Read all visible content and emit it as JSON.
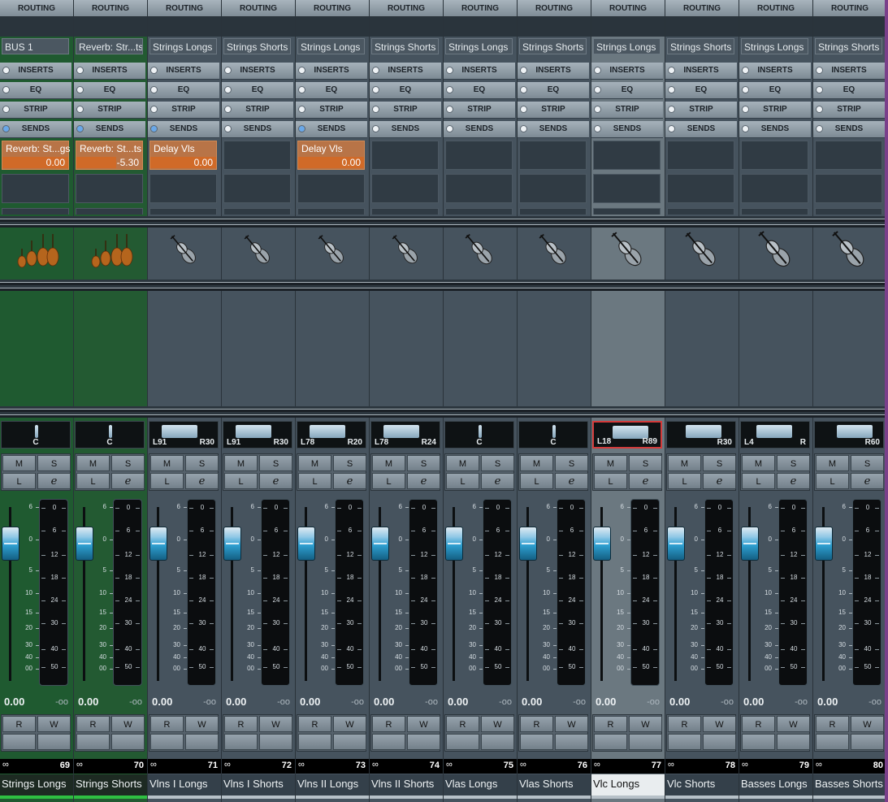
{
  "section_labels": {
    "routing": "ROUTING",
    "inserts": "INSERTS",
    "eq": "EQ",
    "strip": "STRIP",
    "sends": "SENDS"
  },
  "buttons": {
    "mute": "M",
    "solo": "S",
    "listen": "L",
    "edit": "e",
    "read": "R",
    "write": "W"
  },
  "colors": {
    "green_channel": "#1f5a30",
    "green_channel_alt": "#235a32",
    "gray_channel": "#46535e",
    "selected_channel": "#6b7880",
    "green_colorbar": "#2fbf42",
    "gray_colorbar": "#b7c1c8",
    "selected_name_bg": "#e9edef",
    "send_active": "#b87447",
    "selected_pan_border": "#d33b3b",
    "fader_blue": "#2e9fd0"
  },
  "fader_scale": [
    "6",
    "0",
    "5",
    "10",
    "15",
    "20",
    "30",
    "40",
    "00"
  ],
  "meter_scale": [
    "0",
    "6",
    "12",
    "18",
    "24",
    "30",
    "40",
    "50"
  ],
  "channels": [
    {
      "output": "BUS 1",
      "sends_led": true,
      "send": {
        "name": "Reverb: St...gs",
        "value": "0.00",
        "level": 1.0
      },
      "icon": "string-section-icon",
      "pan": {
        "left": "",
        "right": "",
        "center": "C",
        "position": 0.5
      },
      "volume": "0.00",
      "peak": "-oo",
      "number": "69",
      "name": "Strings Longs",
      "color": "green"
    },
    {
      "output": "Reverb: Str...ts",
      "sends_led": true,
      "send": {
        "name": "Reverb: St...ts",
        "value": "-5.30",
        "level": 0.6
      },
      "icon": "string-section-icon",
      "pan": {
        "left": "",
        "right": "",
        "center": "C",
        "position": 0.5
      },
      "volume": "0.00",
      "peak": "-oo",
      "number": "70",
      "name": "Strings Shorts",
      "color": "green"
    },
    {
      "output": "Strings Longs",
      "sends_led": true,
      "send": {
        "name": "Delay Vls",
        "value": "0.00",
        "level": 1.0
      },
      "icon": "violin-icon",
      "pan": {
        "left": "L91",
        "right": "R30",
        "center": "",
        "position": 0.4
      },
      "volume": "0.00",
      "peak": "-oo",
      "number": "71",
      "name": "Vlns I Longs",
      "color": "gray"
    },
    {
      "output": "Strings Shorts",
      "sends_led": false,
      "send": null,
      "icon": "violin-icon",
      "pan": {
        "left": "L91",
        "right": "R30",
        "center": "",
        "position": 0.4
      },
      "volume": "0.00",
      "peak": "-oo",
      "number": "72",
      "name": "Vlns I Shorts",
      "color": "gray"
    },
    {
      "output": "Strings Longs",
      "sends_led": true,
      "send": {
        "name": "Delay Vls",
        "value": "0.00",
        "level": 1.0
      },
      "icon": "violin-icon",
      "pan": {
        "left": "L78",
        "right": "R20",
        "center": "",
        "position": 0.4
      },
      "volume": "0.00",
      "peak": "-oo",
      "number": "73",
      "name": "Vlns II Longs",
      "color": "gray"
    },
    {
      "output": "Strings Shorts",
      "sends_led": false,
      "send": null,
      "icon": "violin-icon",
      "pan": {
        "left": "L78",
        "right": "R24",
        "center": "",
        "position": 0.4
      },
      "volume": "0.00",
      "peak": "-oo",
      "number": "74",
      "name": "Vlns II Shorts",
      "color": "gray"
    },
    {
      "output": "Strings Longs",
      "sends_led": false,
      "send": null,
      "icon": "viola-icon",
      "pan": {
        "left": "",
        "right": "",
        "center": "C",
        "position": 0.5
      },
      "volume": "0.00",
      "peak": "-oo",
      "number": "75",
      "name": "Vlas Longs",
      "color": "gray"
    },
    {
      "output": "Strings Shorts",
      "sends_led": false,
      "send": null,
      "icon": "viola-icon",
      "pan": {
        "left": "",
        "right": "",
        "center": "C",
        "position": 0.5
      },
      "volume": "0.00",
      "peak": "-oo",
      "number": "76",
      "name": "Vlas Shorts",
      "color": "gray"
    },
    {
      "output": "Strings Longs",
      "sends_led": false,
      "send": null,
      "icon": "cello-icon",
      "pan": {
        "left": "L18",
        "right": "R89",
        "center": "",
        "position": 0.6
      },
      "volume": "0.00",
      "peak": "-oo",
      "number": "77",
      "name": "Vlc Longs",
      "color": "selected"
    },
    {
      "output": "Strings Shorts",
      "sends_led": false,
      "send": null,
      "icon": "cello-icon",
      "pan": {
        "left": "",
        "right": "R30",
        "center": "",
        "position": 0.6
      },
      "volume": "0.00",
      "peak": "-oo",
      "number": "78",
      "name": "Vlc Shorts",
      "color": "gray"
    },
    {
      "output": "Strings Longs",
      "sends_led": false,
      "send": null,
      "icon": "double-bass-icon",
      "pan": {
        "left": "L4",
        "right": "R",
        "center": "",
        "position": 0.5
      },
      "volume": "0.00",
      "peak": "-oo",
      "number": "79",
      "name": "Basses Longs",
      "color": "gray"
    },
    {
      "output": "Strings Shorts",
      "sends_led": false,
      "send": null,
      "icon": "double-bass-icon",
      "pan": {
        "left": "",
        "right": "R60",
        "center": "",
        "position": 0.7
      },
      "volume": "0.00",
      "peak": "-oo",
      "number": "80",
      "name": "Basses Shorts",
      "color": "gray"
    }
  ]
}
